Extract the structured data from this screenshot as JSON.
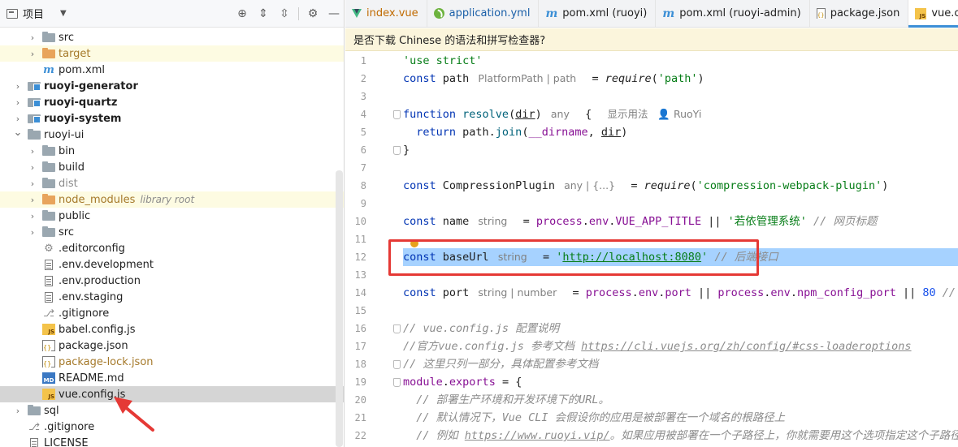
{
  "project": {
    "title": "项目",
    "tools": [
      "crosshair-icon",
      "expand-all-icon",
      "collapse-all-icon",
      "gear-icon",
      "minimize-icon"
    ]
  },
  "tree": [
    {
      "label": "src",
      "type": "folder",
      "indent": 1,
      "arrow": "›"
    },
    {
      "label": "target",
      "type": "folder-orange",
      "indent": 1,
      "arrow": "›",
      "style": "excluded",
      "highlight": true
    },
    {
      "label": "pom.xml",
      "type": "maven",
      "indent": 1,
      "arrow": ""
    },
    {
      "label": "ruoyi-generator",
      "type": "module",
      "indent": 0,
      "arrow": "›",
      "style": "bold"
    },
    {
      "label": "ruoyi-quartz",
      "type": "module",
      "indent": 0,
      "arrow": "›",
      "style": "bold"
    },
    {
      "label": "ruoyi-system",
      "type": "module",
      "indent": 0,
      "arrow": "›",
      "style": "bold"
    },
    {
      "label": "ruoyi-ui",
      "type": "folder",
      "indent": 0,
      "arrow": "⌄"
    },
    {
      "label": "bin",
      "type": "folder",
      "indent": 1,
      "arrow": "›"
    },
    {
      "label": "build",
      "type": "folder",
      "indent": 1,
      "arrow": "›"
    },
    {
      "label": "dist",
      "type": "folder",
      "indent": 1,
      "arrow": "›",
      "style": "muted"
    },
    {
      "label": "node_modules",
      "type": "folder-orange",
      "indent": 1,
      "arrow": "›",
      "style": "excluded",
      "hint": "library root",
      "highlight": true
    },
    {
      "label": "public",
      "type": "folder",
      "indent": 1,
      "arrow": "›"
    },
    {
      "label": "src",
      "type": "folder",
      "indent": 1,
      "arrow": "›"
    },
    {
      "label": ".editorconfig",
      "type": "gear",
      "indent": 1,
      "arrow": ""
    },
    {
      "label": ".env.development",
      "type": "text",
      "indent": 1,
      "arrow": ""
    },
    {
      "label": ".env.production",
      "type": "text",
      "indent": 1,
      "arrow": ""
    },
    {
      "label": ".env.staging",
      "type": "text",
      "indent": 1,
      "arrow": ""
    },
    {
      "label": ".gitignore",
      "type": "git",
      "indent": 1,
      "arrow": ""
    },
    {
      "label": "babel.config.js",
      "type": "js",
      "indent": 1,
      "arrow": ""
    },
    {
      "label": "package.json",
      "type": "json",
      "indent": 1,
      "arrow": ""
    },
    {
      "label": "package-lock.json",
      "type": "json",
      "indent": 1,
      "arrow": "",
      "style": "excluded"
    },
    {
      "label": "README.md",
      "type": "md",
      "indent": 1,
      "arrow": ""
    },
    {
      "label": "vue.config.js",
      "type": "js",
      "indent": 1,
      "arrow": "",
      "selected": true
    },
    {
      "label": "sql",
      "type": "folder",
      "indent": 0,
      "arrow": "›"
    },
    {
      "label": ".gitignore",
      "type": "git",
      "indent": 0,
      "arrow": ""
    },
    {
      "label": "LICENSE",
      "type": "text",
      "indent": 0,
      "arrow": ""
    }
  ],
  "tabs": [
    {
      "label": "index.vue",
      "icon": "vue-icon",
      "style": "vue"
    },
    {
      "label": "application.yml",
      "icon": "spring-icon",
      "style": "yml"
    },
    {
      "label": "pom.xml (ruoyi)",
      "icon": "maven-icon",
      "style": ""
    },
    {
      "label": "pom.xml (ruoyi-admin)",
      "icon": "maven-icon",
      "style": ""
    },
    {
      "label": "package.json",
      "icon": "json-icon",
      "style": ""
    },
    {
      "label": "vue.c",
      "icon": "js-icon",
      "style": "",
      "active": true
    }
  ],
  "notification": "是否下载 Chinese 的语法和拼写检查器?",
  "editor": {
    "current_line": 12,
    "fold_lines": [
      4,
      6,
      16,
      18,
      19
    ],
    "bulb_line": 11,
    "lines": [
      {
        "n": "1",
        "tokens": [
          [
            "s",
            "'use strict'"
          ]
        ]
      },
      {
        "n": "2",
        "tokens": [
          [
            "k",
            "const "
          ],
          [
            "plain",
            "path "
          ],
          [
            "hint",
            "PlatformPath | path"
          ],
          [
            "plain",
            "  = "
          ],
          [
            "fi",
            "require"
          ],
          [
            "plain",
            "("
          ],
          [
            "s",
            "'path'"
          ],
          [
            "plain",
            ")"
          ]
        ]
      },
      {
        "n": "3",
        "tokens": []
      },
      {
        "n": "4",
        "tokens": [
          [
            "k",
            "function "
          ],
          [
            "f",
            "resolve"
          ],
          [
            "plain",
            "("
          ],
          [
            "u",
            "dir"
          ],
          [
            "plain",
            ") "
          ],
          [
            "hint",
            "any"
          ],
          [
            "plain",
            "  {  "
          ],
          [
            "hint",
            "显示用法   👤 RuoYi"
          ]
        ]
      },
      {
        "n": "5",
        "tokens": [
          [
            "k",
            "  return "
          ],
          [
            "plain",
            "path."
          ],
          [
            "f",
            "join"
          ],
          [
            "plain",
            "("
          ],
          [
            "v",
            "__dirname"
          ],
          [
            "plain",
            ", "
          ],
          [
            "u",
            "dir"
          ],
          [
            "plain",
            ")"
          ]
        ]
      },
      {
        "n": "6",
        "tokens": [
          [
            "plain",
            "}"
          ]
        ]
      },
      {
        "n": "7",
        "tokens": []
      },
      {
        "n": "8",
        "tokens": [
          [
            "k",
            "const "
          ],
          [
            "plain",
            "CompressionPlugin "
          ],
          [
            "hint",
            "any | {...}"
          ],
          [
            "plain",
            "  = "
          ],
          [
            "fi",
            "require"
          ],
          [
            "plain",
            "("
          ],
          [
            "s",
            "'compression-webpack-plugin'"
          ],
          [
            "plain",
            ")"
          ]
        ]
      },
      {
        "n": "9",
        "tokens": []
      },
      {
        "n": "10",
        "tokens": [
          [
            "k",
            "const "
          ],
          [
            "plain",
            "name "
          ],
          [
            "hint",
            "string"
          ],
          [
            "plain",
            "  = "
          ],
          [
            "v",
            "process"
          ],
          [
            "plain",
            "."
          ],
          [
            "v",
            "env"
          ],
          [
            "plain",
            "."
          ],
          [
            "v",
            "VUE_APP_TITLE"
          ],
          [
            "plain",
            " || "
          ],
          [
            "s",
            "'若依管理系统'"
          ],
          [
            "c",
            " // 网页标题"
          ]
        ]
      },
      {
        "n": "11",
        "tokens": []
      },
      {
        "n": "12",
        "tokens": [
          [
            "k",
            "const "
          ],
          [
            "plain",
            "baseUrl "
          ],
          [
            "hint",
            "string"
          ],
          [
            "plain",
            "  = "
          ],
          [
            "s",
            "'"
          ],
          [
            "su",
            "http://localhost:8080"
          ],
          [
            "s",
            "'"
          ],
          [
            "c",
            " // 后端接口"
          ]
        ]
      },
      {
        "n": "13",
        "tokens": []
      },
      {
        "n": "14",
        "tokens": [
          [
            "k",
            "const "
          ],
          [
            "plain",
            "port "
          ],
          [
            "hint",
            "string | number"
          ],
          [
            "plain",
            "  = "
          ],
          [
            "v",
            "process"
          ],
          [
            "plain",
            "."
          ],
          [
            "v",
            "env"
          ],
          [
            "plain",
            "."
          ],
          [
            "v",
            "port"
          ],
          [
            "plain",
            " || "
          ],
          [
            "v",
            "process"
          ],
          [
            "plain",
            "."
          ],
          [
            "v",
            "env"
          ],
          [
            "plain",
            "."
          ],
          [
            "v",
            "npm_config_port"
          ],
          [
            "plain",
            " || "
          ],
          [
            "num",
            "80"
          ],
          [
            "c",
            " // 端"
          ]
        ]
      },
      {
        "n": "15",
        "tokens": []
      },
      {
        "n": "16",
        "tokens": [
          [
            "c",
            "// vue.config.js 配置说明"
          ]
        ]
      },
      {
        "n": "17",
        "tokens": [
          [
            "c",
            "//官方vue.config.js 参考文档 "
          ],
          [
            "cu",
            "https://cli.vuejs.org/zh/config/#css-loaderoptions"
          ]
        ]
      },
      {
        "n": "18",
        "tokens": [
          [
            "c",
            "// 这里只列一部分，具体配置参考文档"
          ]
        ]
      },
      {
        "n": "19",
        "tokens": [
          [
            "v",
            "module"
          ],
          [
            "plain",
            "."
          ],
          [
            "v",
            "exports"
          ],
          [
            "plain",
            " = {"
          ]
        ]
      },
      {
        "n": "20",
        "tokens": [
          [
            "c",
            "  // 部署生产环境和开发环境下的URL。"
          ]
        ]
      },
      {
        "n": "21",
        "tokens": [
          [
            "c",
            "  // 默认情况下，Vue CLI 会假设你的应用是被部署在一个域名的根路径上"
          ]
        ]
      },
      {
        "n": "22",
        "tokens": [
          [
            "c",
            "  // 例如 "
          ],
          [
            "cu",
            "https://www.ruoyi.vip/"
          ],
          [
            "c",
            "。如果应用被部署在一个子路径上，你就需要用这个选项指定这个子路径。例"
          ]
        ]
      }
    ]
  }
}
